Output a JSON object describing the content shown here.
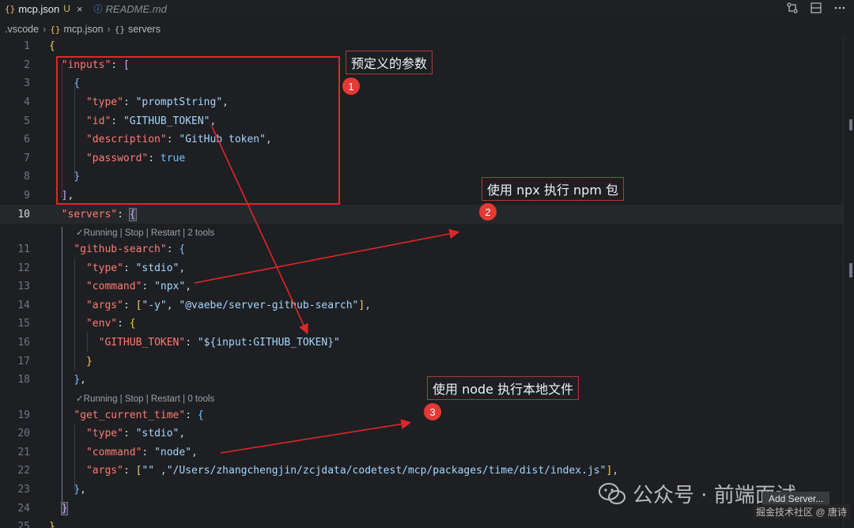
{
  "tabs": [
    {
      "icon": "{}",
      "label": "mcp.json",
      "status": "U",
      "close": "×"
    },
    {
      "icon": "ⓘ",
      "label": "README.md"
    }
  ],
  "breadcrumb": [
    ".vscode",
    "mcp.json",
    "servers"
  ],
  "line_numbers": [
    "1",
    "2",
    "3",
    "4",
    "5",
    "6",
    "7",
    "8",
    "9",
    "10",
    "11",
    "12",
    "13",
    "14",
    "15",
    "16",
    "17",
    "18",
    "19",
    "20",
    "21",
    "22",
    "23",
    "24",
    "25"
  ],
  "codelens": [
    "✓Running | Stop | Restart | 2 tools",
    "✓Running | Stop | Restart | 0 tools"
  ],
  "code": {
    "l2_key": "\"inputs\"",
    "l4_key": "\"type\"",
    "l4_val": "\"promptString\"",
    "l5_key": "\"id\"",
    "l5_val": "\"GITHUB_TOKEN\"",
    "l6_key": "\"description\"",
    "l6_val": "\"GitHub token\"",
    "l7_key": "\"password\"",
    "l7_val": "true",
    "l10_key": "\"servers\"",
    "l11_key": "\"github-search\"",
    "l12_key": "\"type\"",
    "l12_val": "\"stdio\"",
    "l13_key": "\"command\"",
    "l13_val": "\"npx\"",
    "l14_key": "\"args\"",
    "l14_v1": "\"-y\"",
    "l14_v2": "\"@vaebe/server-github-search\"",
    "l15_key": "\"env\"",
    "l16_key": "\"GITHUB_TOKEN\"",
    "l16_val": "\"${input:GITHUB_TOKEN}\"",
    "l19_key": "\"get_current_time\"",
    "l20_key": "\"type\"",
    "l20_val": "\"stdio\"",
    "l21_key": "\"command\"",
    "l21_val": "\"node\"",
    "l22_key": "\"args\"",
    "l22_v1": "\"\"",
    "l22_v2": "\"/Users/zhangchengjin/zcjdata/codetest/mcp/packages/time/dist/index.js\""
  },
  "annotations": [
    {
      "number": "1",
      "text": "预定义的参数"
    },
    {
      "number": "2",
      "text": "使用 npx 执行 npm 包"
    },
    {
      "number": "3",
      "text": "使用 node 执行本地文件"
    }
  ],
  "watermark": {
    "text": "公众号 · 前端面试"
  },
  "add_server_label": "Add Server...",
  "credit": "掘金技术社区 @ 唐诗",
  "colors": {
    "annotation_red": "#e0262a",
    "string": "#a5d6ff",
    "key": "#ff7b72"
  }
}
